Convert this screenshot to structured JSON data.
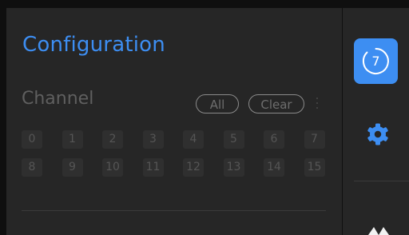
{
  "config": {
    "title": "Configuration",
    "channel": {
      "label": "Channel",
      "all_label": "All",
      "clear_label": "Clear",
      "channels": [
        "0",
        "1",
        "2",
        "3",
        "4",
        "5",
        "6",
        "7",
        "8",
        "9",
        "10",
        "11",
        "12",
        "13",
        "14",
        "15"
      ]
    }
  },
  "rail": {
    "badge_value": "7",
    "icons": [
      "timer-icon",
      "gear-icon",
      "waveform-icon"
    ]
  },
  "colors": {
    "accent": "#3d8ef2",
    "background": "#262626"
  }
}
